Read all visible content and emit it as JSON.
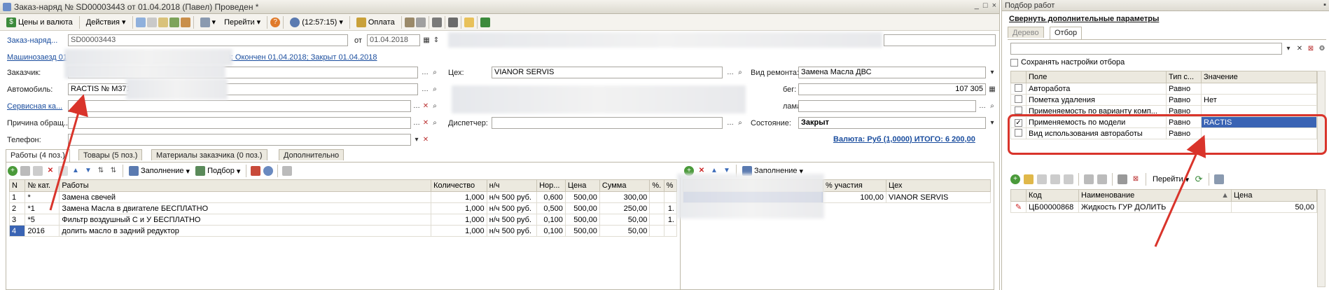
{
  "window": {
    "title": "Заказ-наряд № SD00003443 от 01.04.2018 (Павел) Проведен *",
    "controls": [
      "_",
      "□",
      "×"
    ]
  },
  "toolbar": {
    "items": [
      "Цены и валюта",
      "Действия",
      "Перейти",
      "(12:57:15)",
      "Оплата"
    ]
  },
  "header": {
    "number_label": "Заказ-наряд...",
    "number_value": "SD00003443",
    "date_label": "от",
    "date_value": "01.04.2018",
    "status_link": "Машинозаезд 01.04.2018; Сдача 01.04.2018; Начат 01.04.2018; Окончен 01.04.2018; Закрыт 01.04.2018"
  },
  "form": {
    "customer_label": "Заказчик:",
    "car_label": "Автомобиль:",
    "car_value": "RACTIS № M371",
    "service_card_label": "Сервисная ка...",
    "reason_label": "Причина обращ...",
    "phone_label": "Телефон:",
    "shop_label": "Цех:",
    "shop_value": "VIANOR SERVIS",
    "dispatcher_label": "Диспетчер:",
    "repair_type_label": "Вид ремонта:",
    "repair_type_value": "Замена Масла ДВС",
    "mileage_label": "бег:",
    "mileage_value": "107 305",
    "claim_label": "лама:",
    "state_label": "Состояние:",
    "state_value": "Закрыт",
    "currency_total": "Валюта: Руб (1,0000) ИТОГО: 6 200,00"
  },
  "tabs": [
    {
      "label": "Работы (4 поз.)"
    },
    {
      "label": "Товары (5 поз.)"
    },
    {
      "label": "Материалы заказчика (0 поз.)"
    },
    {
      "label": "Дополнительно"
    }
  ],
  "works_toolbar": {
    "fill": "Заполнение",
    "select": "Подбор"
  },
  "works_table": {
    "columns": [
      "N",
      "№ кат.",
      "Работы",
      "Количество",
      "н/ч",
      "Нор...",
      "Цена",
      "Сумма",
      "%.",
      "%"
    ],
    "rows": [
      [
        "1",
        "*",
        "Замена свечей",
        "1,000",
        "н/ч 500 руб.",
        "0,600",
        "500,00",
        "300,00",
        "",
        ""
      ],
      [
        "2",
        "*1",
        "Замена Масла в двигателе БЕСПЛАТНО",
        "1,000",
        "н/ч 500 руб.",
        "0,500",
        "500,00",
        "250,00",
        "",
        "1."
      ],
      [
        "3",
        "*5",
        "Фильтр воздушный С и У БЕСПЛАТНО",
        "1,000",
        "н/ч 500 руб.",
        "0,100",
        "500,00",
        "50,00",
        "",
        "1."
      ],
      [
        "4",
        "2016",
        "долить масло в задний редуктор",
        "1,000",
        "н/ч 500 руб.",
        "0,100",
        "500,00",
        "50,00",
        "",
        ""
      ]
    ]
  },
  "exec_toolbar": {
    "fill": "Заполнение"
  },
  "exec_table": {
    "columns": [
      "",
      "% участия",
      "Цех"
    ],
    "rows": [
      [
        "",
        "100,00",
        "VIANOR SERVIS"
      ]
    ]
  },
  "picker": {
    "title": "Подбор работ",
    "collapse_link": "Свернуть дополнительные параметры",
    "tabs": [
      "Дерево",
      "Отбор"
    ],
    "save_settings_label": "Сохранять настройки отбора",
    "filter_columns": [
      "Поле",
      "Тип с...",
      "Значение"
    ],
    "filter_rows": [
      {
        "checked": false,
        "field": "Авторабота",
        "type": "Равно",
        "value": ""
      },
      {
        "checked": false,
        "field": "Пометка удаления",
        "type": "Равно",
        "value": "Нет"
      },
      {
        "checked": false,
        "field": "Применяемость по варианту комп...",
        "type": "Равно",
        "value": ""
      },
      {
        "checked": true,
        "field": "Применяемость по модели",
        "type": "Равно",
        "value": "RACTIS"
      },
      {
        "checked": false,
        "field": "Вид использования автоработы",
        "type": "Равно",
        "value": ""
      }
    ],
    "goto_label": "Перейти",
    "result_columns": [
      "Код",
      "Наименование",
      "Цена"
    ],
    "result_rows": [
      {
        "code": "ЦБ00000868",
        "name": "Жидкость ГУР ДОЛИТЬ",
        "price": "50,00"
      }
    ]
  },
  "colors": {
    "annotation": "#d9342b",
    "selection": "#3a64b4",
    "link": "#1a4d9e"
  }
}
